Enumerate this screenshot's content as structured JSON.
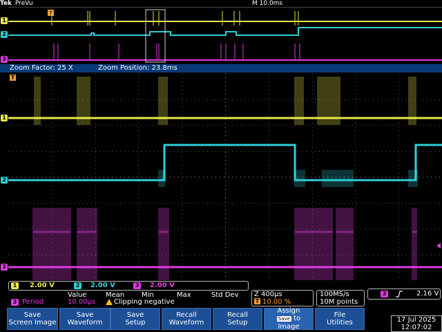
{
  "header": {
    "brand": "Tek",
    "mode": "PreVu",
    "timebase": "M 10.0ms"
  },
  "zoom": {
    "factor": "Zoom Factor: 25 X",
    "position": "Zoom Position: 23.8ms"
  },
  "colors": {
    "ch1": "#e8e84a",
    "ch2": "#2fd0d8",
    "ch3": "#e03ce0",
    "button_bg": "#1d4f96",
    "bar_bg": "#0a3a78",
    "trigger": "#f0a030"
  },
  "markers": {
    "ch1": "1",
    "ch2": "2",
    "ch3": "3",
    "trigger_icon": "trigger-T-icon",
    "trigger_label": "T"
  },
  "channels": {
    "ch1": {
      "num": "1",
      "scale": "2.00 V"
    },
    "ch2": {
      "num": "2",
      "scale": "2.00 V"
    },
    "ch3": {
      "num": "3",
      "scale": "2.00 V"
    }
  },
  "measurement": {
    "col_value": "Value",
    "col_mean": "Mean",
    "col_min": "Min",
    "col_max": "Max",
    "col_stddev": "Std Dev",
    "source": "3",
    "name": "Period",
    "value": "10.00µs",
    "warning": "Clipping negative"
  },
  "horizontal": {
    "zoom_scale": "Z 400µs",
    "trigger_pos": "10.00 %",
    "sample_rate": "100MS/s",
    "record_length": "10M points"
  },
  "trigger": {
    "source": "3",
    "slope_icon": "rising-edge-icon",
    "level": "2.16 V"
  },
  "buttons": [
    {
      "line1": "Save",
      "line2": "Screen Image"
    },
    {
      "line1": "Save",
      "line2": "Waveform"
    },
    {
      "line1": "Save",
      "line2": "Setup"
    },
    {
      "line1": "Recall",
      "line2": "Waveform"
    },
    {
      "line1": "Recall",
      "line2": "Setup"
    },
    {
      "line1": "Assign",
      "badge": "Save",
      "to": "to",
      "line2": "Image"
    },
    {
      "line1": "File",
      "line2": "Utilities"
    }
  ],
  "datetime": {
    "date": "17 Jul  2025",
    "time": "12:07:02"
  }
}
